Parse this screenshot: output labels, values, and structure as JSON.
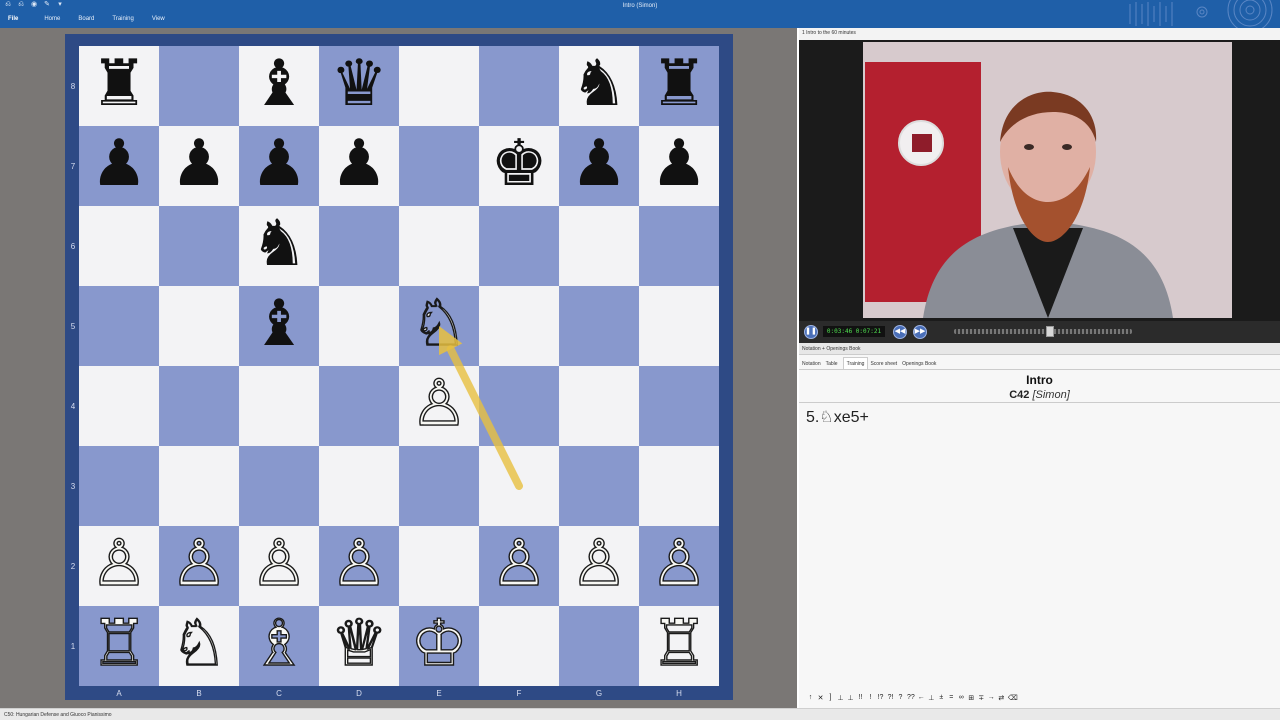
{
  "window": {
    "title": "Intro  (Simon)"
  },
  "quick_access": [
    "⎌",
    "⎌",
    "◉",
    "✎",
    "▾"
  ],
  "ribbon": {
    "tabs": [
      "File",
      "Home",
      "Board",
      "Training",
      "View"
    ]
  },
  "board": {
    "files": [
      "A",
      "B",
      "C",
      "D",
      "E",
      "F",
      "G",
      "H"
    ],
    "ranks": [
      "8",
      "7",
      "6",
      "5",
      "4",
      "3",
      "2",
      "1"
    ],
    "position": [
      [
        "♜",
        "",
        "♝",
        "♛",
        "",
        "",
        "♞",
        "♜"
      ],
      [
        "♟",
        "♟",
        "♟",
        "♟",
        "",
        "♚",
        "♟",
        "♟"
      ],
      [
        "",
        "",
        "♞",
        "",
        "",
        "",
        "",
        ""
      ],
      [
        "",
        "",
        "♝",
        "",
        "♘",
        "",
        "",
        ""
      ],
      [
        "",
        "",
        "",
        "",
        "♙",
        "",
        "",
        ""
      ],
      [
        "",
        "",
        "",
        "",
        "",
        "",
        "",
        ""
      ],
      [
        "♙",
        "♙",
        "♙",
        "♙",
        "",
        "♙",
        "♙",
        "♙"
      ],
      [
        "♖",
        "♘",
        "♗",
        "♕",
        "♔",
        "",
        "",
        "♖"
      ]
    ],
    "arrow": {
      "from": "f3",
      "to": "e5",
      "color": "#e8c040"
    },
    "colors": {
      "light": "#f3f3f5",
      "dark": "#8898cd",
      "frame": "#2e4a85"
    }
  },
  "video": {
    "caption": "1 Intro to the 60 minutes",
    "timecode": "0:03:46 0:07:21",
    "seek_fraction": 0.54,
    "controls": {
      "pause_icon": "pause-icon",
      "rewind_icon": "rewind-icon",
      "forward_icon": "forward-icon"
    }
  },
  "notation": {
    "header": "Notation + Openings Book",
    "tabs": [
      "Notation",
      "Table",
      "Training",
      "Score sheet",
      "Openings Book"
    ],
    "active_tab": "Training",
    "game_title": "Intro",
    "eco": "C42",
    "player": "[Simon]",
    "moves": "5.♘xe5+",
    "toolbar": [
      "↑",
      "✕",
      "]",
      "⊥",
      "⊥",
      "!!",
      "!",
      "!?",
      "?!",
      "?",
      "??",
      "←",
      "⊥",
      "±",
      "=",
      "∞",
      "⊞",
      "∓",
      "→",
      "⇄",
      "⌫"
    ]
  },
  "statusbar": {
    "text": "C50: Hungarian Defense and Giuoco Pianissimo"
  }
}
